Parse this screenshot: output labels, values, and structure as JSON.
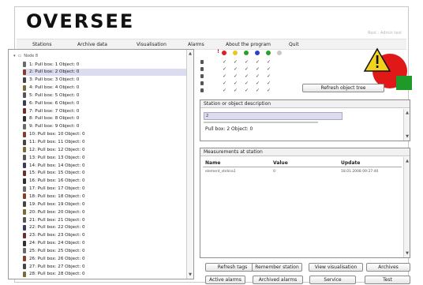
{
  "app": {
    "logo": "OVERSEE",
    "user_info": "Rost : Admin test"
  },
  "menu": [
    "Stations",
    "Archive data",
    "Visualisation",
    "Alarms",
    "About the program",
    "Quit"
  ],
  "tree": {
    "root_label": "Node 8",
    "items": [
      "1: Pull box: 1 Object: 0",
      "2: Pull box: 2 Object: 0",
      "3: Pull box: 3 Object: 0",
      "4: Pull box: 4 Object: 0",
      "5: Pull box: 5 Object: 0",
      "6: Pull box: 6 Object: 0",
      "7: Pull box: 7 Object: 0",
      "8: Pull box: 8 Object: 0",
      "9: Pull box: 9 Object: 0",
      "10: Pull box: 10 Object: 0",
      "11: Pull box: 11 Object: 0",
      "12: Pull box: 12 Object: 0",
      "13: Pull box: 13 Object: 0",
      "14: Pull box: 14 Object: 0",
      "15: Pull box: 15 Object: 0",
      "16: Pull box: 16 Object: 0",
      "17: Pull box: 17 Object: 0",
      "18: Pull box: 18 Object: 0",
      "19: Pull box: 19 Object: 0",
      "20: Pull box: 20 Object: 0",
      "21: Pull box: 21 Object: 0",
      "22: Pull box: 22 Object: 0",
      "23: Pull box: 23 Object: 0",
      "24: Pull box: 24 Object: 0",
      "25: Pull box: 25 Object: 0",
      "26: Pull box: 26 Object: 0",
      "27: Pull box: 27 Object: 0",
      "28: Pull box: 28 Object: 0"
    ],
    "selected_index": 1,
    "icon_colors": [
      "#6a6a6a",
      "#8a3b2a",
      "#444444",
      "#7a6a3a",
      "#555555",
      "#3a3a5a",
      "#6b2f2f",
      "#2f2f2f"
    ]
  },
  "status_colors": [
    "#e02020",
    "#e8c81e",
    "#2aa02a",
    "#2a40c8",
    "#2aa02a",
    "#c8c8c8"
  ],
  "buttons": {
    "refresh_tree": "Refresh object tree",
    "refresh_tags": "Refresh tags",
    "remember_station": "Remember station",
    "view_visualisation": "View visualisation",
    "archives": "Archives",
    "active_alarms": "Active alarms",
    "archived_alarms": "Archived alarms",
    "service": "Service",
    "test": "Test"
  },
  "description": {
    "title": "Station or object description",
    "field_value": "2",
    "text": "Pull box: 2 Object: 0"
  },
  "measurements": {
    "title": "Measurements at station",
    "columns": [
      "Name",
      "Value",
      "Update"
    ],
    "rows": [
      {
        "name": "element_stelina1",
        "value": "0",
        "update": "18.01.2008 09:27:40"
      }
    ]
  },
  "colors": {
    "warning_yellow": "#f2d21b",
    "alarm_red": "#e01818",
    "ok_green": "#1e9a2a"
  }
}
